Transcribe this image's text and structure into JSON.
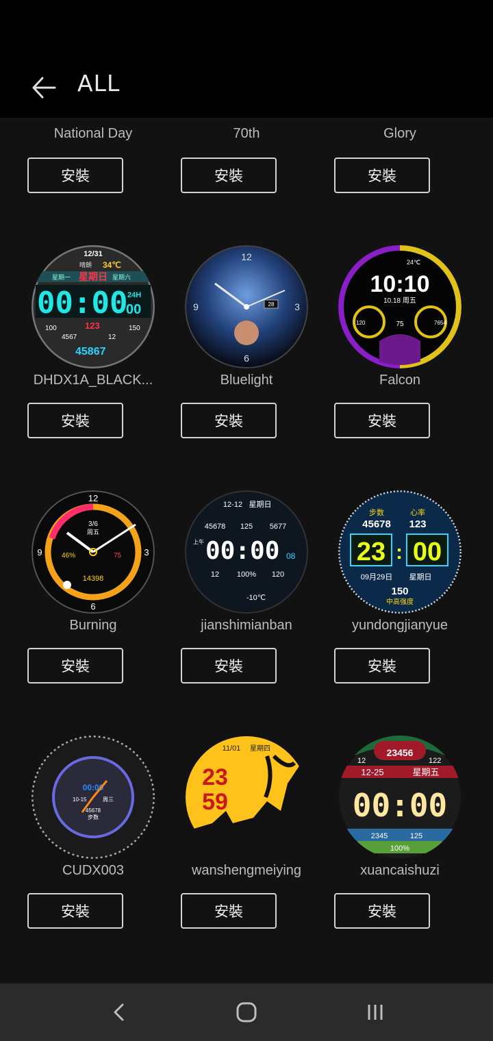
{
  "header": {
    "title": "ALL",
    "back_icon": "arrow-left-icon"
  },
  "install_label": "安裝",
  "partial_row": [
    {
      "name": "National Day"
    },
    {
      "name": "70th"
    },
    {
      "name": "Glory"
    }
  ],
  "rows": [
    [
      {
        "name": "DHDX1A_BLACK...",
        "face": {
          "date": "12/31",
          "weather": "晴朗",
          "temp": "34℃",
          "week_left": "星期一",
          "week_center": "星期日",
          "week_right": "星期六",
          "time": "00:00",
          "mode": "24H",
          "sec": "00",
          "steps": "100",
          "kcal": "150",
          "heart": "123",
          "dist": "4567",
          "floor": "12",
          "total": "45867"
        }
      },
      {
        "name": "Bluelight",
        "face": {
          "n12": "12",
          "n3": "3",
          "n6": "6",
          "n9": "9",
          "date": "28"
        }
      },
      {
        "name": "Falcon",
        "face": {
          "temp": "24℃",
          "time": "10:10",
          "date": "10.18 周五",
          "left": "120",
          "heart": "75",
          "right": "7654"
        }
      }
    ],
    [
      {
        "name": "Burning",
        "face": {
          "n12": "12",
          "n3": "3",
          "n6": "6",
          "n9": "9",
          "date": "3/6",
          "weekday": "周五",
          "battery": "46%",
          "heart": "75",
          "steps": "14398"
        }
      },
      {
        "name": "jianshimianban",
        "face": {
          "date": "12-12",
          "weekday": "星期日",
          "a": "45678",
          "b": "125",
          "c": "5677",
          "ampm": "上午",
          "time": "00:00",
          "sec": "08",
          "d": "12",
          "e": "100%",
          "f": "120",
          "temp": "-10℃"
        }
      },
      {
        "name": "yundongjianyue",
        "face": {
          "steps_label": "步数",
          "heart_label": "心率",
          "steps": "45678",
          "heart": "123",
          "hour": "23",
          "minute": "00",
          "date": "09月29日",
          "weekday": "星期日",
          "bottom": "150",
          "intensity": "中高强度"
        }
      }
    ],
    [
      {
        "name": "CUDX003",
        "face": {
          "time": "00:00",
          "date": "10-15",
          "weekday": "周三",
          "steps": "45678",
          "steps_label": "步数"
        }
      },
      {
        "name": "wanshengmeiying",
        "face": {
          "date": "11/01",
          "weekday": "星期四",
          "hour": "23",
          "minute": "59"
        }
      },
      {
        "name": "xuancaishuzi",
        "face": {
          "steps": "23456",
          "a": "12",
          "b": "122",
          "date": "12-25",
          "weekday": "星期五",
          "time": "00:00",
          "c": "2345",
          "d": "125",
          "battery": "100%"
        }
      }
    ]
  ],
  "nav": {
    "back_icon": "nav-back-icon",
    "home_icon": "nav-home-icon",
    "recents_icon": "nav-recents-icon"
  }
}
